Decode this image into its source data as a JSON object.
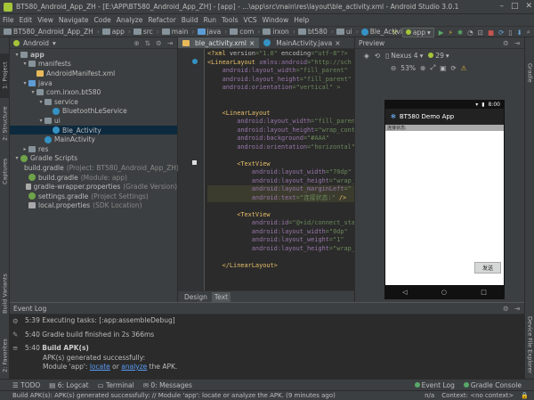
{
  "window": {
    "title": "BT580_Android_App_ZH - [E:\\APP\\BT580_Android_App_ZH] - [app] - ...\\app\\src\\main\\res\\layout\\ble_activity.xml - Android Studio 3.0.1"
  },
  "menu": [
    "File",
    "Edit",
    "View",
    "Navigate",
    "Code",
    "Analyze",
    "Refactor",
    "Build",
    "Run",
    "Tools",
    "VCS",
    "Window",
    "Help"
  ],
  "breadcrumbs": [
    "BT580_Android_App_ZH",
    "app",
    "src",
    "main",
    "java",
    "com",
    "irxon",
    "bt580",
    "ui",
    "Ble_Activity"
  ],
  "toolbar": {
    "run_config": "app"
  },
  "left_tabs": [
    "1: Project",
    "2: Structure",
    "Captures",
    "Build Variants",
    "2: Favorites"
  ],
  "right_tabs": [
    "Gradle",
    "Device File Explorer"
  ],
  "project": {
    "view_label": "Android",
    "tree": [
      {
        "label": "app",
        "indent": 0,
        "icon": "folder",
        "bold": true
      },
      {
        "label": "manifests",
        "indent": 1,
        "icon": "folder"
      },
      {
        "label": "AndroidManifest.xml",
        "indent": 2,
        "icon": "xml"
      },
      {
        "label": "java",
        "indent": 1,
        "icon": "folder-blue"
      },
      {
        "label": "com.irxon.bt580",
        "indent": 2,
        "icon": "folder"
      },
      {
        "label": "service",
        "indent": 3,
        "icon": "folder"
      },
      {
        "label": "BluetoothLeService",
        "indent": 4,
        "icon": "class"
      },
      {
        "label": "ui",
        "indent": 3,
        "icon": "folder"
      },
      {
        "label": "Ble_Activity",
        "indent": 4,
        "icon": "class",
        "selected": true
      },
      {
        "label": "MainActivity",
        "indent": 3,
        "icon": "class"
      },
      {
        "label": "res",
        "indent": 1,
        "icon": "folder"
      },
      {
        "label": "Gradle Scripts",
        "indent": 0,
        "icon": "gradle"
      },
      {
        "label": "build.gradle",
        "suffix": "(Project: BT580_Android_App_ZH)",
        "indent": 1,
        "icon": "gradle"
      },
      {
        "label": "build.gradle",
        "suffix": "(Module: app)",
        "indent": 1,
        "icon": "gradle"
      },
      {
        "label": "gradle-wrapper.properties",
        "suffix": "(Gradle Version)",
        "indent": 1,
        "icon": "props"
      },
      {
        "label": "settings.gradle",
        "suffix": "(Project Settings)",
        "indent": 1,
        "icon": "gradle"
      },
      {
        "label": "local.properties",
        "suffix": "(SDK Location)",
        "indent": 1,
        "icon": "props"
      }
    ]
  },
  "editor": {
    "tabs": [
      {
        "label": "ble_activity.xml",
        "active": true
      },
      {
        "label": "MainActivity.java",
        "active": false
      }
    ],
    "lines": [
      [
        [
          "<?xml ",
          "tag"
        ],
        [
          "version",
          "attr"
        ],
        [
          "=\"1.0\" ",
          "val"
        ],
        [
          "encoding",
          "attr"
        ],
        [
          "=\"utf-8\"?>",
          "val"
        ]
      ],
      [
        [
          "<LinearLayout ",
          "tag"
        ],
        [
          "xmlns:android",
          "ns"
        ],
        [
          "=\"http://sch",
          "val"
        ]
      ],
      [
        [
          "    android:layout_width",
          "ns"
        ],
        [
          "=\"fill_parent\"",
          "val"
        ]
      ],
      [
        [
          "    android:layout_height",
          "ns"
        ],
        [
          "=\"fill_parent\"",
          "val"
        ]
      ],
      [
        [
          "    android:orientation",
          "ns"
        ],
        [
          "=\"vertical\" >",
          "val"
        ]
      ],
      [
        [
          "",
          ""
        ]
      ],
      [
        [
          "",
          ""
        ]
      ],
      [
        [
          "    <LinearLayout",
          "tag"
        ]
      ],
      [
        [
          "        android:layout_width",
          "ns"
        ],
        [
          "=\"fill_paren",
          "val"
        ]
      ],
      [
        [
          "        android:layout_height",
          "ns"
        ],
        [
          "=\"wrap_cont",
          "val"
        ]
      ],
      [
        [
          "        android:background",
          "ns"
        ],
        [
          "=\"#AAA\"",
          "val"
        ]
      ],
      [
        [
          "        android:orientation",
          "ns"
        ],
        [
          "=\"horizontal\"",
          "val"
        ]
      ],
      [
        [
          "",
          ""
        ]
      ],
      [
        [
          "        <TextView",
          "tag"
        ]
      ],
      [
        [
          "            android:layout_width",
          "ns"
        ],
        [
          "=\"70dp\"",
          "val"
        ]
      ],
      [
        [
          "            android:layout_height",
          "ns"
        ],
        [
          "=\"wrap_",
          "val"
        ]
      ],
      [
        [
          "            android:layout_marginLeft",
          "ns"
        ],
        [
          "=\"",
          "val"
        ]
      ],
      [
        [
          "            android:text",
          "ns"
        ],
        [
          "=\"连接状态:\" ",
          "val"
        ],
        [
          "/>",
          "tag"
        ]
      ],
      [
        [
          "",
          ""
        ]
      ],
      [
        [
          "        <TextView",
          "tag"
        ]
      ],
      [
        [
          "            android:id",
          "ns"
        ],
        [
          "=\"@+id/connect_sta",
          "val"
        ]
      ],
      [
        [
          "            android:layout_width",
          "ns"
        ],
        [
          "=\"0dp\"",
          "val"
        ]
      ],
      [
        [
          "            android:layout_weight",
          "ns"
        ],
        [
          "=\"1\"",
          "val"
        ]
      ],
      [
        [
          "            android:layout_height",
          "ns"
        ],
        [
          "=\"wrap_",
          "val"
        ]
      ],
      [
        [
          "",
          ""
        ]
      ],
      [
        [
          "    </LinearLayout>",
          "tag"
        ]
      ]
    ],
    "design_tabs": [
      "Design",
      "Text"
    ]
  },
  "preview": {
    "title": "Preview",
    "device": "Nexus 4",
    "api": "29",
    "zoom": "53%",
    "app_title": "BT580 Demo App",
    "status_time": "8:00",
    "connect_label": "连接状态:",
    "send_button": "发送"
  },
  "event_log": {
    "title": "Event Log",
    "entries": [
      {
        "time": "5:39",
        "text": "Executing tasks: [:app:assembleDebug]"
      },
      {
        "time": "5:40",
        "text": "Gradle build finished in 2s 366ms"
      },
      {
        "time": "5:40",
        "text": "Build APK(s)",
        "bold": true
      },
      {
        "time": "",
        "text": "APK(s) generated successfully:"
      },
      {
        "time": "",
        "text": "Module 'app':",
        "link1": "locate",
        "mid": "or",
        "link2": "analyze",
        "end": "the APK."
      }
    ]
  },
  "bottom_tabs": [
    "TODO",
    "6: Logcat",
    "Terminal",
    "0: Messages",
    "Event Log",
    "Gradle Console"
  ],
  "status": {
    "message": "Build APK(s): APK(s) generated successfully: // Module 'app': locate or analyze the APK. (9 minutes ago)",
    "na": "n/a",
    "context": "Context: <no context>"
  },
  "colors": {
    "accent": "#589df6",
    "selection": "#0d293e",
    "background": "#2b2b2b",
    "panel": "#3c3f41"
  }
}
